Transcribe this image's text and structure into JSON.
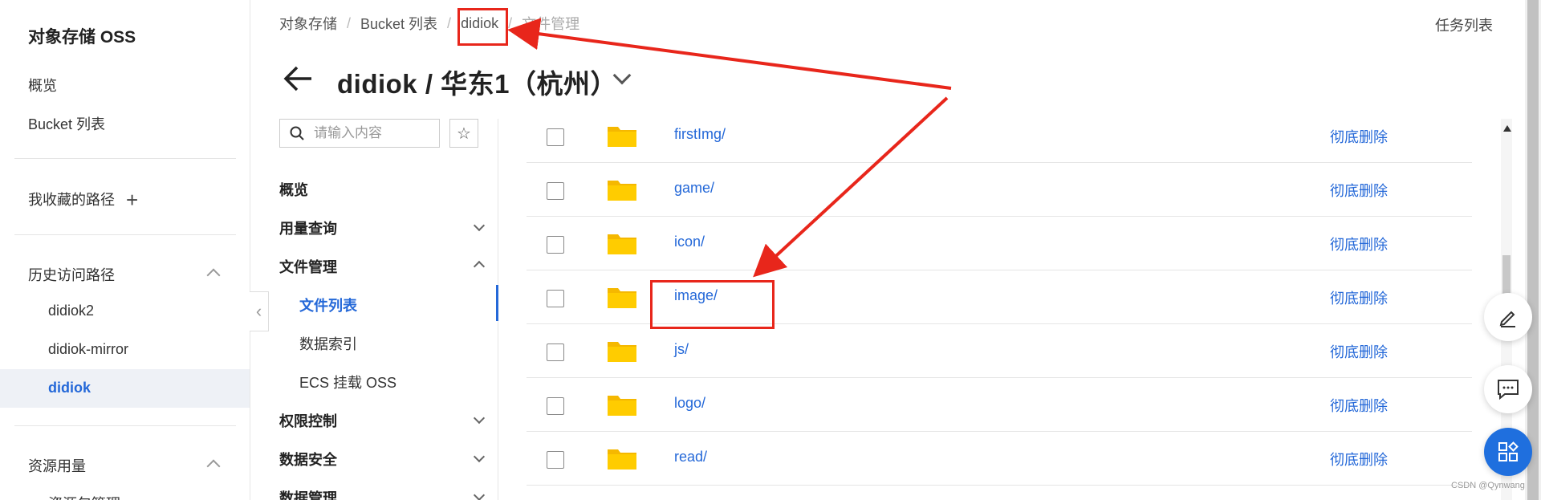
{
  "global_sidebar": {
    "title": "对象存储 OSS",
    "overview": "概览",
    "bucket_list": "Bucket 列表",
    "favorites": "我收藏的路径",
    "history": {
      "label": "历史访问路径",
      "items": [
        "didiok2",
        "didiok-mirror",
        "didiok"
      ]
    },
    "resource_usage": "资源用量",
    "resource_pack": "资源包管理"
  },
  "breadcrumb": [
    "对象存储",
    "Bucket 列表",
    "didiok",
    "文件管理"
  ],
  "task_list": "任务列表",
  "page_title": "didiok / 华东1（杭州）",
  "secondary_nav": {
    "search_placeholder": "请输入内容",
    "items": [
      {
        "label": "概览"
      },
      {
        "label": "用量查询"
      },
      {
        "label": "文件管理"
      },
      {
        "label": "文件列表"
      },
      {
        "label": "数据索引"
      },
      {
        "label": "ECS 挂载 OSS"
      },
      {
        "label": "权限控制"
      },
      {
        "label": "数据安全"
      },
      {
        "label": "数据管理"
      }
    ]
  },
  "files": [
    {
      "name": "firstImg/",
      "action": "彻底删除"
    },
    {
      "name": "game/",
      "action": "彻底删除"
    },
    {
      "name": "icon/",
      "action": "彻底删除"
    },
    {
      "name": "image/",
      "action": "彻底删除"
    },
    {
      "name": "js/",
      "action": "彻底删除"
    },
    {
      "name": "logo/",
      "action": "彻底删除"
    },
    {
      "name": "read/",
      "action": "彻底删除"
    }
  ],
  "watermark": "CSDN @Qynwang",
  "colors": {
    "accent": "#2468d8",
    "annotation": "#e8261b",
    "folder": "#ffcc00"
  }
}
